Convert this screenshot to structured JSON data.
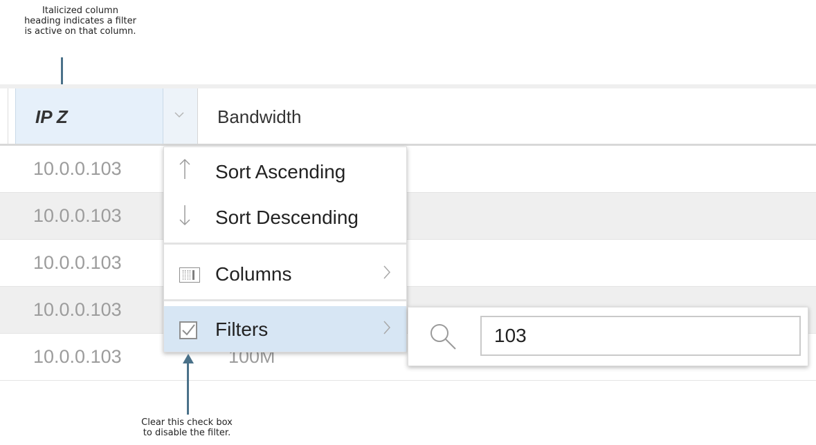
{
  "callouts": {
    "top": [
      "Italicized column",
      "heading indicates a filter",
      "is active on that column."
    ],
    "bottom": [
      "Clear this check box",
      "to disable the filter."
    ]
  },
  "header": {
    "ip_column": "IP Z",
    "bandwidth_column": "Bandwidth",
    "trigger_icon": "chevron-down-icon"
  },
  "rows": [
    {
      "ip": "10.0.0.103",
      "bandwidth": ""
    },
    {
      "ip": "10.0.0.103",
      "bandwidth": ""
    },
    {
      "ip": "10.0.0.103",
      "bandwidth": ""
    },
    {
      "ip": "10.0.0.103",
      "bandwidth": ""
    },
    {
      "ip": "10.0.0.103",
      "bandwidth": "100M"
    }
  ],
  "menu": {
    "sort_asc": {
      "label": "Sort Ascending",
      "icon": "arrow-up-icon"
    },
    "sort_desc": {
      "label": "Sort Descending",
      "icon": "arrow-down-icon"
    },
    "columns": {
      "label": "Columns",
      "icon": "columns-icon"
    },
    "filters": {
      "label": "Filters",
      "icon": "checkbox-icon",
      "checked": true
    }
  },
  "filter": {
    "value": "103",
    "icon": "search-icon"
  },
  "colors": {
    "arrow": "#4a7189",
    "header_active": "#e6f0fa",
    "menu_selected": "#d7e6f4"
  }
}
